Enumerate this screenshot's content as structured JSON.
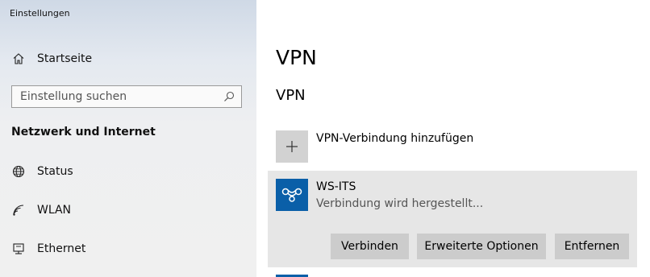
{
  "window": {
    "title": "Einstellungen"
  },
  "sidebar": {
    "home_label": "Startseite",
    "search_placeholder": "Einstellung suchen",
    "section_heading": "Netzwerk und Internet",
    "items": [
      {
        "label": "Status",
        "icon": "globe-icon"
      },
      {
        "label": "WLAN",
        "icon": "wifi-icon"
      },
      {
        "label": "Ethernet",
        "icon": "ethernet-icon"
      }
    ]
  },
  "main": {
    "title": "VPN",
    "section_heading": "VPN",
    "add_label": "VPN-Verbindung hinzufügen",
    "connection": {
      "name": "WS-ITS",
      "status": "Verbindung wird hergestellt...",
      "buttons": {
        "connect": "Verbinden",
        "advanced": "Erweiterte Optionen",
        "remove": "Entfernen"
      }
    }
  },
  "colors": {
    "accent": "#0a5fa8",
    "card_bg": "#e6e6e6",
    "button_bg": "#cccccc",
    "add_tile_bg": "#d2d2d2"
  }
}
